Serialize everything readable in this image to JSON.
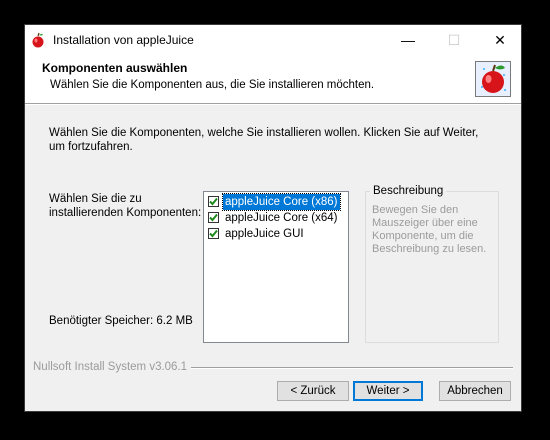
{
  "window": {
    "title": "Installation von appleJuice",
    "minimize_glyph": "—",
    "maximize_glyph": "☐",
    "close_glyph": "✕",
    "icon": "apple-icon"
  },
  "header": {
    "title": "Komponenten auswählen",
    "subtitle": "Wählen Sie die Komponenten aus, die Sie installieren möchten.",
    "logo": "apple-logo"
  },
  "body": {
    "intro": "Wählen Sie die Komponenten, welche Sie installieren wollen. Klicken Sie auf Weiter, um fortzufahren.",
    "components_label": "Wählen Sie die zu installierenden Komponenten:",
    "components": [
      {
        "label": "appleJuice Core (x86)",
        "checked": true,
        "selected": true
      },
      {
        "label": "appleJuice Core (x64)",
        "checked": true,
        "selected": false
      },
      {
        "label": "appleJuice GUI",
        "checked": true,
        "selected": false
      }
    ],
    "description_title": "Beschreibung",
    "description_text": "Bewegen Sie den Mauszeiger über eine Komponente, um die Beschreibung zu lesen.",
    "space_required": "Benötigter Speicher: 6.2 MB"
  },
  "footer": {
    "branding": "Nullsoft Install System v3.06.1",
    "back_label": "< Zurück",
    "next_label": "Weiter >",
    "cancel_label": "Abbrechen"
  },
  "colors": {
    "selection": "#0078d7",
    "checkmark": "#1e8a1e",
    "disabled_text": "#9b9b9b"
  }
}
